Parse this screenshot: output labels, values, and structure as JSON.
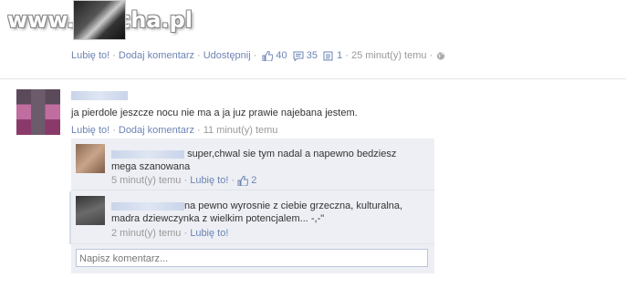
{
  "watermark": "www.wiocha.pl",
  "top_actions": {
    "like": "Lubię to!",
    "comment": "Dodaj komentarz",
    "share": "Udostępnij",
    "likes_count": "40",
    "comments_count": "35",
    "shares_count": "1",
    "time": "25 minut(y) temu"
  },
  "post": {
    "text": "ja pierdole jeszcze nocu nie ma a ja juz prawie najebana jestem.",
    "like": "Lubię to!",
    "comment": "Dodaj komentarz",
    "time": "11 minut(y) temu"
  },
  "comments": [
    {
      "text": "super,chwal sie tym nadal a napewno bedziesz mega szanowana",
      "time": "5 minut(y) temu",
      "like": "Lubię to!",
      "likes": "2"
    },
    {
      "text": "na pewno wyrosnie z ciebie grzeczna, kulturalna, madra dziewczynka z wielkim potencjalem... -,-\"",
      "time": "2 minut(y) temu",
      "like": "Lubię to!"
    }
  ],
  "comment_input": {
    "placeholder": "Napisz komentarz..."
  },
  "colors": {
    "link": "#6d84b4",
    "comment_bg": "#edeff4",
    "meta": "#999999"
  },
  "icons": [
    "thumbs-up-icon",
    "comment-bubble-icon",
    "share-icon",
    "globe-icon"
  ]
}
